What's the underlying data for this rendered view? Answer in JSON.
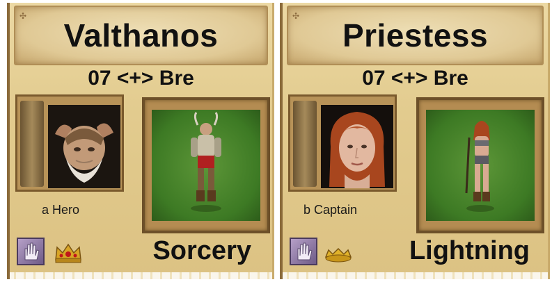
{
  "cards": [
    {
      "name": "Valthanos",
      "subtitle": "07 <+> Bre",
      "unit_label": "a Hero",
      "magic_school": "Sorcery",
      "icons": {
        "spell": "hand-spell-icon",
        "rank": "ruby-crown-icon"
      }
    },
    {
      "name": "Priestess",
      "subtitle": "07 <+> Bre",
      "unit_label": "b Captain",
      "magic_school": "Lightning",
      "icons": {
        "spell": "hand-spell-icon",
        "rank": "gold-circlet-icon"
      }
    }
  ],
  "colors": {
    "parchment": "#e2cb8e",
    "frame": "#7a5a2d",
    "grass": "#3d7a24",
    "text": "#111111"
  }
}
